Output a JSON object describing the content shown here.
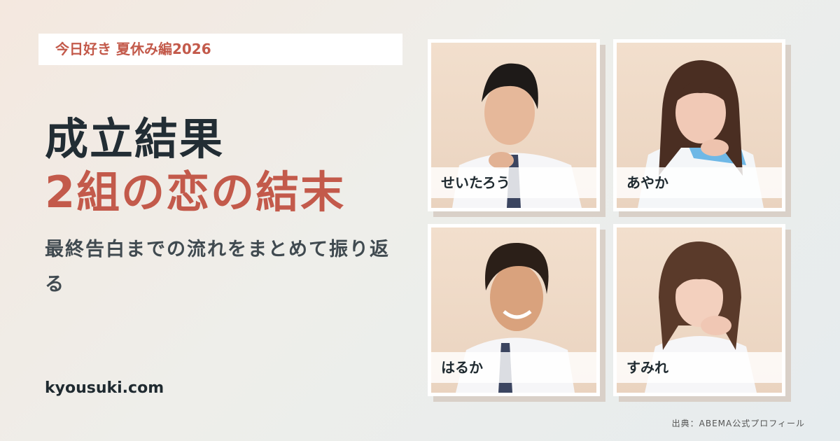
{
  "header": {
    "tag": "今日好き 夏休み編2026"
  },
  "headline": {
    "line1": "成立結果",
    "line2": "2組の恋の結末"
  },
  "subtitle": "最終告白までの流れをまとめて振り返る",
  "site": "kyousuki.com",
  "credit": "出典：ABEMA公式プロフィール",
  "cast": [
    {
      "name": "せいたろう"
    },
    {
      "name": "あやか"
    },
    {
      "name": "はるか"
    },
    {
      "name": "すみれ"
    }
  ],
  "colors": {
    "accent": "#c35a4b",
    "dark": "#222d34",
    "card_shadow": "#d9d0c8"
  }
}
